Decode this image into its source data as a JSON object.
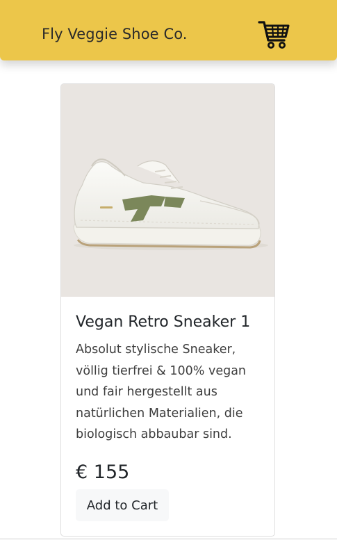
{
  "navbar": {
    "brand": "Fly Veggie Shoe Co.",
    "cart_icon": "shopping-cart-icon",
    "background": "#ecc64a"
  },
  "product": {
    "image_icon": "sneaker-image",
    "title": "Vegan Retro Sneaker 1",
    "description": "Absolut stylische Sneaker, völlig tierfrei & 100% vegan und fair hergestellt aus natürlichen Materialien, die biologisch abbaubar sind.",
    "price": "€ 155",
    "add_button_label": "Add to Cart"
  }
}
